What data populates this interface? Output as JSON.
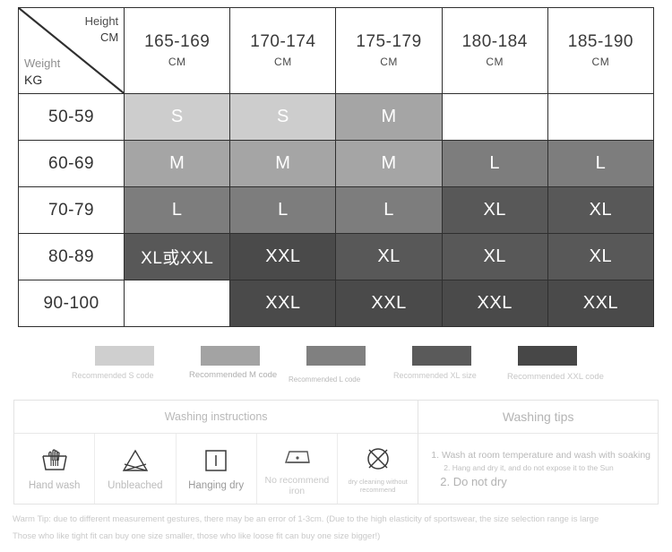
{
  "table": {
    "corner": {
      "height_label": "Height",
      "height_unit": "CM",
      "weight_label": "Weight",
      "weight_unit": "KG"
    },
    "height_columns": [
      {
        "range": "165-169",
        "unit": "CM"
      },
      {
        "range": "170-174",
        "unit": "CM"
      },
      {
        "range": "175-179",
        "unit": "CM"
      },
      {
        "range": "180-184",
        "unit": "CM"
      },
      {
        "range": "185-190",
        "unit": "CM"
      }
    ],
    "rows": [
      {
        "weight": "50-59",
        "cells": [
          {
            "value": "S",
            "size": "S"
          },
          {
            "value": "S",
            "size": "S"
          },
          {
            "value": "M",
            "size": "M"
          },
          {
            "value": "/",
            "size": "none"
          },
          {
            "value": "/",
            "size": "none"
          }
        ]
      },
      {
        "weight": "60-69",
        "cells": [
          {
            "value": "M",
            "size": "M"
          },
          {
            "value": "M",
            "size": "M"
          },
          {
            "value": "M",
            "size": "M"
          },
          {
            "value": "L",
            "size": "L"
          },
          {
            "value": "L",
            "size": "L"
          }
        ]
      },
      {
        "weight": "70-79",
        "cells": [
          {
            "value": "L",
            "size": "L"
          },
          {
            "value": "L",
            "size": "L"
          },
          {
            "value": "L",
            "size": "L"
          },
          {
            "value": "XL",
            "size": "XL"
          },
          {
            "value": "XL",
            "size": "XL"
          }
        ]
      },
      {
        "weight": "80-89",
        "cells": [
          {
            "value": "XL或XXL",
            "size": "XL"
          },
          {
            "value": "XXL",
            "size": "XXL"
          },
          {
            "value": "XL",
            "size": "XL"
          },
          {
            "value": "XL",
            "size": "XL"
          },
          {
            "value": "XL",
            "size": "XL"
          }
        ]
      },
      {
        "weight": "90-100",
        "cells": [
          {
            "value": "/",
            "size": "none"
          },
          {
            "value": "XXL",
            "size": "XXL"
          },
          {
            "value": "XXL",
            "size": "XXL"
          },
          {
            "value": "XXL",
            "size": "XXL"
          },
          {
            "value": "XXL",
            "size": "XXL"
          }
        ]
      }
    ],
    "size_colors": {
      "S": "#cdcdcd",
      "M": "#a5a5a5",
      "L": "#7d7d7d",
      "XL": "#585858",
      "XXL": "#4a4a4a",
      "none": "#ffffff"
    }
  },
  "legend": [
    {
      "label": "Recommended S code",
      "color": "#cfcfcf"
    },
    {
      "label": "Recommended M code",
      "color": "#a3a3a3"
    },
    {
      "label": "Recommended L code",
      "color": "#808080"
    },
    {
      "label": "Recommended XL size",
      "color": "#5a5a5a"
    },
    {
      "label": "Recommended XXL code",
      "color": "#474747"
    }
  ],
  "wash": {
    "instructions_title": "Washing instructions",
    "tips_title": "Washing tips",
    "icons": [
      {
        "icon": "hand-wash-icon",
        "label": "Hand wash"
      },
      {
        "icon": "do-not-bleach-icon",
        "label": "Unbleached"
      },
      {
        "icon": "line-dry-icon",
        "label": "Hanging dry"
      },
      {
        "icon": "do-not-iron-icon",
        "label": "No recommend iron"
      },
      {
        "icon": "do-not-dry-clean-icon",
        "label": "dry cleaning without recommend"
      }
    ],
    "tips": [
      "1. Wash at room temperature and wash with soaking",
      "2. Hang and dry it, and do not expose it to the Sun",
      "2. Do not dry"
    ]
  },
  "warm_tip": {
    "line1": "Warm Tip: due to different measurement gestures, there may be an error of 1-3cm. (Due to the high elasticity of sportswear, the size selection range is large",
    "line2": "Those who like tight fit can buy one size smaller, those who like loose fit can buy one size bigger!)"
  }
}
